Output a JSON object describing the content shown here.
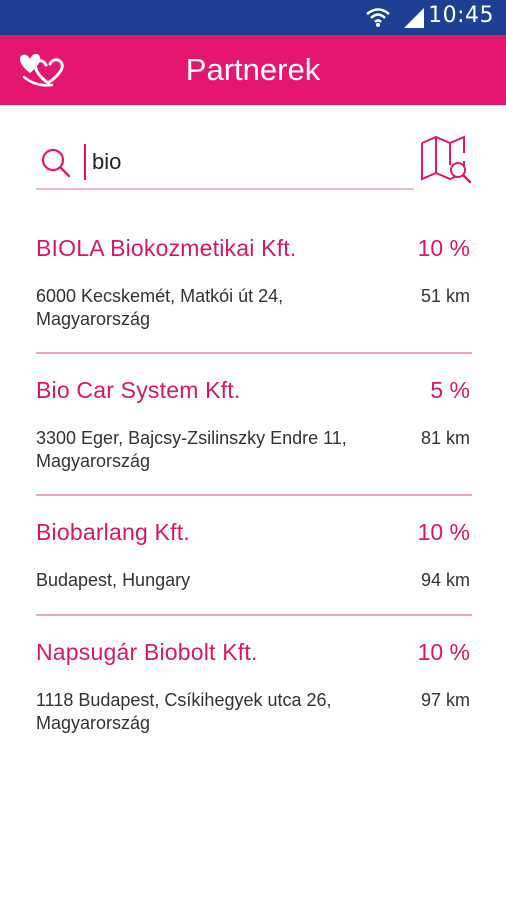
{
  "status_bar": {
    "time": "10:45",
    "icons": [
      "wifi-icon",
      "signal-icon"
    ]
  },
  "app_bar": {
    "title": "Partnerek",
    "logo_icon": "hearts-logo-icon",
    "color": "#e4166f"
  },
  "search": {
    "value": "bio",
    "icon": "search-icon",
    "map_icon": "map-search-icon"
  },
  "partners": [
    {
      "name": "BIOLA Biokozmetikai Kft.",
      "discount": "10 %",
      "address": "6000 Kecskemét, Matkói út 24, Magyarország",
      "distance": "51 km"
    },
    {
      "name": "Bio Car System Kft.",
      "discount": "5 %",
      "address": "3300 Eger, Bajcsy-Zsilinszky Endre 11, Magyarország",
      "distance": "81 km"
    },
    {
      "name": "Biobarlang Kft.",
      "discount": "10 %",
      "address": "Budapest, Hungary",
      "distance": "94 km"
    },
    {
      "name": "Napsugár Biobolt Kft.",
      "discount": "10 %",
      "address": "1118 Budapest, Csíkihegyek utca 26, Magyarország",
      "distance": "97 km"
    }
  ],
  "colors": {
    "status_bar": "#1d3f94",
    "accent": "#e4166f",
    "divider": "#e8a6c3"
  }
}
